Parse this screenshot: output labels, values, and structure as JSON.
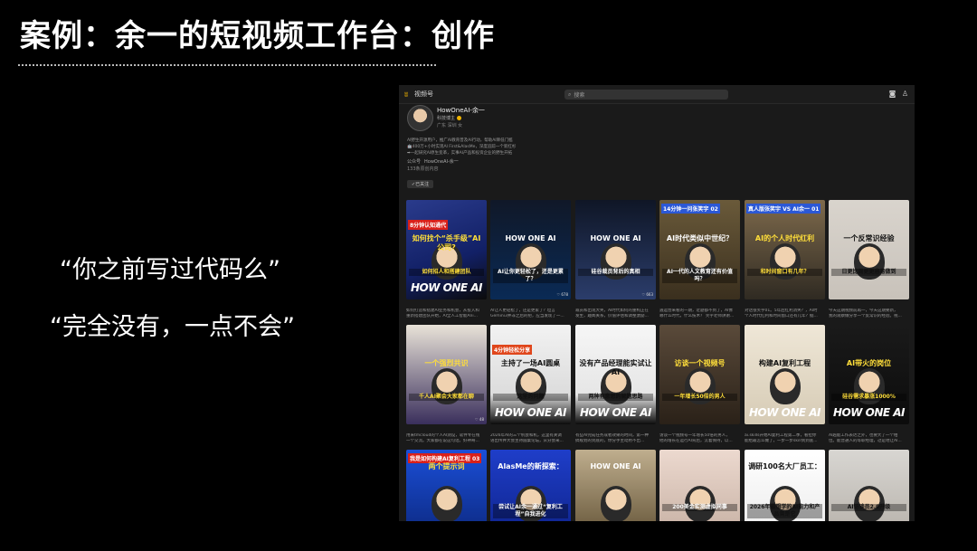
{
  "slide": {
    "title": "案例：余一的短视频工作台：创作",
    "quote1": "“你之前写过代码么”",
    "quote2": "“完全没有，一点不会”"
  },
  "channel": {
    "app_name": "视频号",
    "search_placeholder": "搜索",
    "account_name": "HowOneAI-余一",
    "category": "科技博主",
    "location": "广东 深圳 女",
    "bio_lines": [
      "AI野生开源用户，推广AI教育普及AI行动，帮助AI降低门槛",
      "🤖400万+小时实现AI First&AlasMe，深度追踪一个新红杉",
      "➡一起研究AI原生变革，实事AI产品和投资企业的野生开拓"
    ],
    "public_label": "公众号",
    "public_name": "HowOneAI-余一",
    "fans": "133条原创内容",
    "follow_label": "已关注"
  },
  "videos": [
    {
      "tag": "8分钟认知通代",
      "headline": "如何找个“杀手级”AI公司?",
      "sub": "如何招人和搭建团队",
      "brand": "HOW ONE AI",
      "stat": "",
      "caption1": "如何打造和搭建AI业务和机会，从投入和",
      "caption2": "重新搭建团队开始，AI全人工智能Ani..."
    },
    {
      "tag": "",
      "headline": "HOW ONE AI",
      "sub": "AI让你更轻松了，还是更累了？",
      "brand": "",
      "stat": "678",
      "caption1": "AI让人更轻松了，还是更累了？坦言",
      "caption2": "Gemini3并非之后的把，应当发现了一..."
    },
    {
      "tag": "",
      "headline": "HOW ONE AI",
      "sub": "硅谷裁员背后的真相",
      "brand": "",
      "stat": "663",
      "caption1": "裁员和出现大失，AI时代如何的重构正在",
      "caption2": "发生，趣闻关系，价值评估和调整激励..."
    },
    {
      "tag": "14分钟一问张笑宇 02",
      "headline": "AI时代类似中世纪？",
      "sub": "AI一代的人文教育还有价值吗？",
      "brand": "",
      "stat": "",
      "caption1": "遇运营来看的一期，近题都不到了，AI像",
      "caption2": "哪什么时代，什么技术？ 笑宇老师讲谢..."
    },
    {
      "tag": "真人版张笑宇 VS AI余一 01",
      "headline": "AI的个人时代红利",
      "sub": "和时间窗口有几年？",
      "brand": "",
      "stat": "",
      "caption1": "对话张笑宇01。5年后红利消失？，AI时",
      "caption2": "个人时代红利和时间窗口还有几年？据..."
    },
    {
      "tag": "",
      "headline": "一个反常识经验",
      "sub": "日更比周更更容易做到",
      "brand": "",
      "stat": "",
      "caption1": "今天这期视频前再一，今天这期要新，",
      "caption2": "我的观察做分享一个反常识的经验。视..."
    },
    {
      "tag": "",
      "headline": "一个强烈共识",
      "sub": "千人AI聚会大家都在聊",
      "brand": "",
      "stat": "48",
      "caption1": "用来tmcloud的个人AI测设，软件专在线",
      "caption2": "一个交流。大家都在说这句话。好神奇..."
    },
    {
      "tag": "4分钟轻松分享",
      "headline": "主持了一场AI圆桌",
      "sub": "这里的问题",
      "brand": "HOW ONE AI",
      "stat": "",
      "caption1": "2026年AI的三个机会和机，这里有关调",
      "caption2": "语出传并大会主持圆桌论坛，从分会来..."
    },
    {
      "tag": "",
      "headline": "没有产品经理能实试让AI",
      "sub": "两种有意思的解题思路",
      "brand": "HOW ONE AI",
      "stat": "",
      "caption1": "有些AI完成任务或者效果的时间，第一种",
      "caption2": "搞规划的到底的，你分手主动用不出..."
    },
    {
      "tag": "",
      "headline": "访谈一个视频号",
      "sub": "一年增长50倍的男人",
      "brand": "",
      "stat": "",
      "caption1": "访谈一个视频号一年增长50倍的男人，",
      "caption2": "他的增长在运行AI背后，沉着保持，以..."
    },
    {
      "tag": "",
      "headline": "构建AI复利工程",
      "sub": "",
      "brand": "HOW ONE AI",
      "stat": "",
      "caption1": "ai.skills开始AI复利工程第二季，看拉你",
      "caption2": "能给最怎么做了，一步一步skill到到底..."
    },
    {
      "tag": "",
      "headline": "AI带火的岗位",
      "sub": "硅谷需求暴涨1000%",
      "brand": "HOW ONE AI",
      "stat": "",
      "caption1": "AI越能工作表达之外，也要大了一个相",
      "caption2": "位。能普通人的等职经理，过是地让AI..."
    },
    {
      "tag": "我是如何构建AI复利工程 03",
      "headline": "两个提示词",
      "sub": "",
      "brand": "",
      "stat": "",
      "caption1": "",
      "caption2": ""
    },
    {
      "tag": "",
      "headline": "AlasMe的新探索：",
      "sub": "尝试让AI余一通过“复利工程”自我进化",
      "brand": "",
      "stat": "",
      "caption1": "",
      "caption2": ""
    },
    {
      "tag": "",
      "headline": "HOW ONE AI",
      "sub": "",
      "brand": "",
      "stat": "",
      "caption1": "",
      "caption2": ""
    },
    {
      "tag": "",
      "headline": "",
      "sub": "200美金实测虚拟同事",
      "brand": "",
      "stat": "",
      "caption1": "",
      "caption2": ""
    },
    {
      "tag": "",
      "headline": "调研100名大厂员工：",
      "sub": "2026年最想学的AI能力和产品竟是它",
      "brand": "",
      "stat": "",
      "caption1": "",
      "caption2": ""
    },
    {
      "tag": "",
      "headline": "",
      "sub": "AI访谈员2.0升级",
      "brand": "",
      "stat": "",
      "caption1": "",
      "caption2": ""
    }
  ]
}
